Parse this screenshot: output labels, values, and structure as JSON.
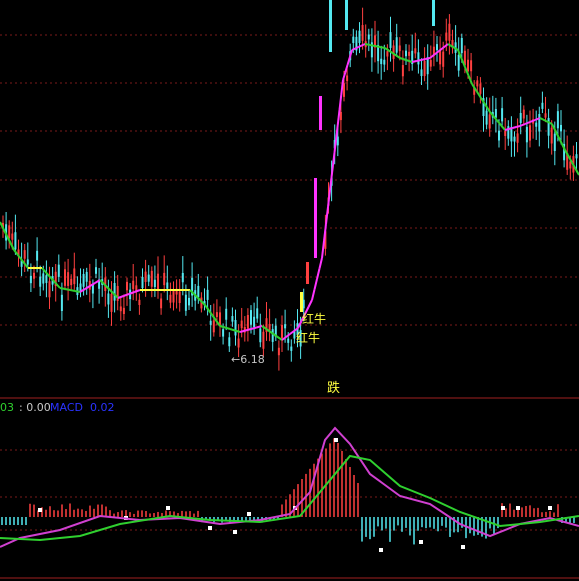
{
  "labels": {
    "fall_marker": "跌",
    "low_price": "←6.18",
    "signal_1": "红牛",
    "signal_2": "红牛"
  },
  "indicator_bar": {
    "name_fragment": "03",
    "value_text": ": 0.00",
    "macd_name": "MACD",
    "macd_value": "0.02"
  },
  "colors": {
    "background": "#000000",
    "grid": "#7a1a1a",
    "rise": "#ff4040",
    "fall": "#54e8f0",
    "ma_up": "#ff33ff",
    "ma_flat": "#ffff40",
    "ma_down": "#2fd02f",
    "dif": "#d040d0",
    "dea": "#2fd02f",
    "macd_pos": "#ff4040",
    "macd_neg": "#54e8f0",
    "marker": "#ffffff"
  },
  "chart_data": [
    {
      "type": "candlestick",
      "title": "",
      "annotations": [
        "跌",
        "←6.18",
        "红牛",
        "红牛"
      ],
      "price_range": [
        6.0,
        9.3
      ],
      "lowest_marked": 6.18,
      "grid": true
    },
    {
      "type": "macd",
      "series": [
        {
          "name": "MACD",
          "last_value": 0.02
        }
      ],
      "grid": true
    }
  ]
}
